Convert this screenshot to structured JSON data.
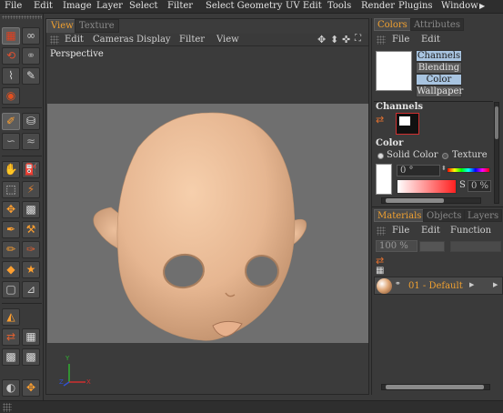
{
  "menubar": {
    "items": [
      "File",
      "Edit",
      "Image",
      "Layer",
      "Select",
      "Filter",
      "Select Geometry",
      "UV Edit",
      "Tools",
      "Render",
      "Plugins",
      "Window"
    ],
    "overflow_icon": "arrow-right-icon"
  },
  "viewport": {
    "tabs": [
      "View",
      "Texture"
    ],
    "menu": [
      "Edit",
      "Cameras",
      "Display",
      "Filter",
      "View"
    ],
    "label": "Perspective",
    "nav_icons": [
      "move-icon",
      "dolly-icon",
      "rotate-icon",
      "fit-icon"
    ],
    "axes": {
      "x": "X",
      "y": "Y",
      "z": "Z"
    },
    "colors": {
      "x": "#d03030",
      "y": "#30b030",
      "z": "#3050d0",
      "head": "#e8b895"
    }
  },
  "colors_panel": {
    "tabs": [
      "Colors",
      "Attributes"
    ],
    "menu": [
      "File",
      "Edit"
    ],
    "buttons": [
      "Channels",
      "Blending",
      "Color",
      "Wallpaper"
    ],
    "active_buttons": [
      "Channels",
      "Color"
    ],
    "channels_title": "Channels",
    "color_title": "Color",
    "solid_color_label": "Solid Color",
    "texture_label": "Texture",
    "hue_value": "0 °",
    "s_label": "S",
    "percent_value": "0 %"
  },
  "materials_panel": {
    "tabs": [
      "Materials",
      "Objects",
      "Layers"
    ],
    "menu": [
      "File",
      "Edit",
      "Function"
    ],
    "opacity_value": "100 %",
    "material_name": "01 - Default"
  }
}
